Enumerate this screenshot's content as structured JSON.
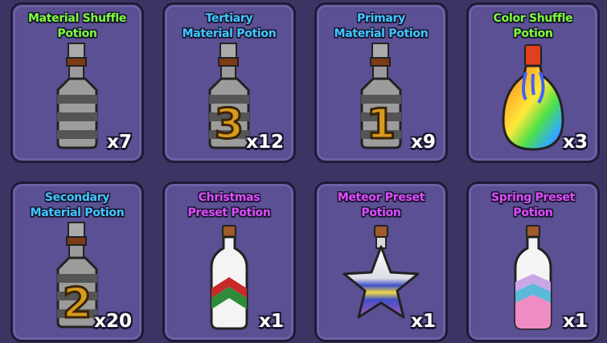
{
  "inventory": {
    "items": [
      {
        "name_line1": "Material Shuffle",
        "name_line2": "Potion",
        "count": "x7",
        "name_color": "#7dff3a",
        "icon": "striped-bottle-icon"
      },
      {
        "name_line1": "Tertiary",
        "name_line2": "Material Potion",
        "count": "x12",
        "name_color": "#3fc8ff",
        "icon": "bottle-3-icon"
      },
      {
        "name_line1": "Primary",
        "name_line2": "Material Potion",
        "count": "x9",
        "name_color": "#3fc8ff",
        "icon": "bottle-1-icon"
      },
      {
        "name_line1": "Color Shuffle",
        "name_line2": "Potion",
        "count": "x3",
        "name_color": "#7dff3a",
        "icon": "rainbow-flask-icon"
      },
      {
        "name_line1": "Secondary",
        "name_line2": "Material Potion",
        "count": "x20",
        "name_color": "#3fc8ff",
        "icon": "bottle-2-icon"
      },
      {
        "name_line1": "Christmas",
        "name_line2": "Preset Potion",
        "count": "x1",
        "name_color": "#e04bff",
        "icon": "christmas-bottle-icon"
      },
      {
        "name_line1": "Meteor Preset",
        "name_line2": "Potion",
        "count": "x1",
        "name_color": "#e04bff",
        "icon": "star-bottle-icon"
      },
      {
        "name_line1": "Spring Preset",
        "name_line2": "Potion",
        "count": "x1",
        "name_color": "#e04bff",
        "icon": "spring-bottle-icon"
      }
    ]
  }
}
